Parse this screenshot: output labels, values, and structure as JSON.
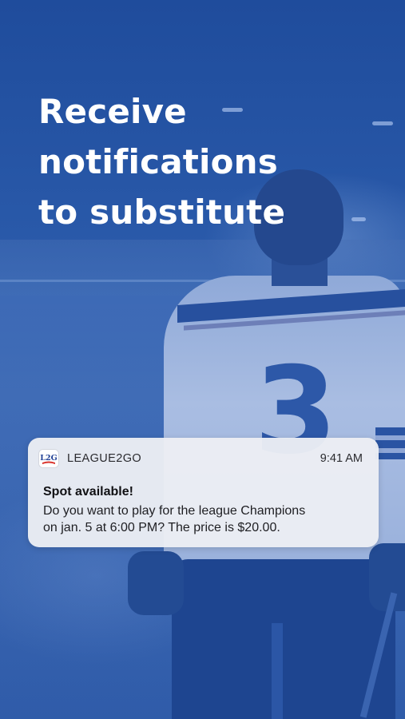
{
  "headline": {
    "lines": [
      "Receive",
      "notifications",
      "to substitute"
    ]
  },
  "background": {
    "photo_subject": "hockey-player",
    "jersey_number": "3"
  },
  "notification": {
    "app_icon": "league2go-logo-icon",
    "app_icon_text": "L2G",
    "app_name": "LEAGUE2GO",
    "time": "9:41 AM",
    "title": "Spot available!",
    "body_lines": [
      "Do you want to play for the league Champions",
      "on jan. 5 at 6:00 PM? The price is $20.00."
    ]
  },
  "colors": {
    "brand_blue": "#2b56a6",
    "headline_text": "#ffffff",
    "card_background": "#eceef4",
    "logo_red": "#d9322b",
    "logo_blue": "#1f3f94"
  }
}
